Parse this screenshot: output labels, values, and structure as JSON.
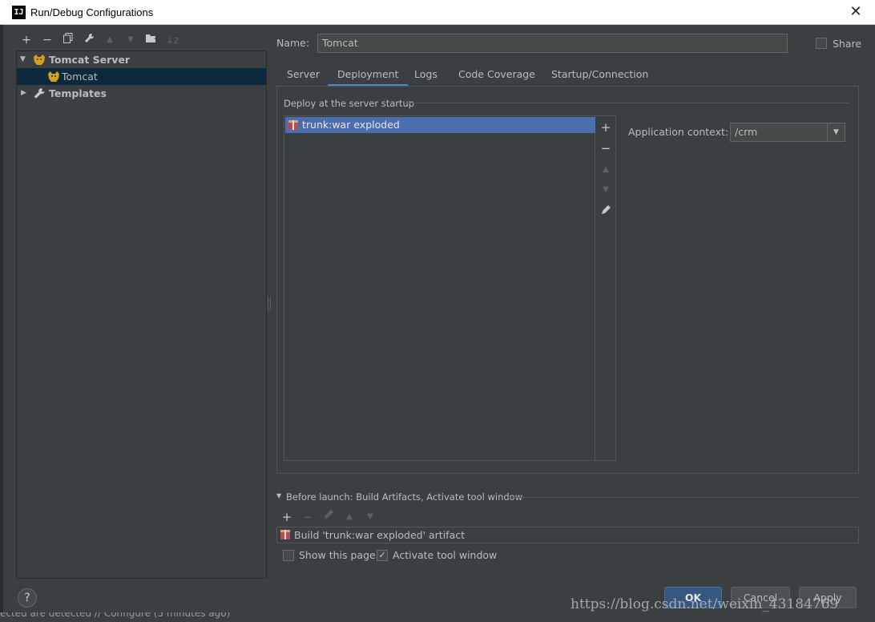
{
  "window": {
    "title": "Run/Debug Configurations",
    "app_icon": "IJ"
  },
  "left_toolbar": {
    "icons": [
      "plus-icon",
      "minus-icon",
      "copy-icon",
      "wrench-icon",
      "arrow-up-icon",
      "arrow-down-icon",
      "folder-add-icon",
      "sort-icon"
    ]
  },
  "tree": {
    "items": [
      {
        "label": "Tomcat Server",
        "icon": "tomcat-icon",
        "expanded": true
      },
      {
        "label": "Tomcat",
        "icon": "tomcat-icon",
        "selected": true
      },
      {
        "label": "Templates",
        "icon": "wrench-icon",
        "expanded": false
      }
    ]
  },
  "form": {
    "name_label": "Name:",
    "name_value": "Tomcat",
    "share_label": "Share",
    "share_checked": false
  },
  "tabs": [
    {
      "label": "Server"
    },
    {
      "label": "Deployment",
      "active": true
    },
    {
      "label": "Logs"
    },
    {
      "label": "Code Coverage"
    },
    {
      "label": "Startup/Connection"
    }
  ],
  "deployment": {
    "group_title": "Deploy at the server startup",
    "items": [
      {
        "label": "trunk:war exploded",
        "selected": true
      }
    ],
    "context_label": "Application context:",
    "context_value": "/crm"
  },
  "before_launch": {
    "title": "Before launch: Build Artifacts, Activate tool window",
    "items": [
      {
        "label": "Build 'trunk:war exploded' artifact"
      }
    ],
    "show_page_label": "Show this page",
    "show_page_checked": false,
    "activate_label": "Activate tool window",
    "activate_checked": true
  },
  "buttons": {
    "help": "?",
    "ok": "OK",
    "cancel": "Cancel",
    "apply": "Apply"
  },
  "status": {
    "text": "ected are detected // Configure (5 minutes ago)"
  },
  "watermark": "https://blog.csdn.net/weixin_43184769",
  "colors": {
    "background": "#3c3f41",
    "selection": "#4b6eaf",
    "tree_selection": "#0d293e",
    "accent": "#4a88c7",
    "primary_button": "#365880"
  }
}
